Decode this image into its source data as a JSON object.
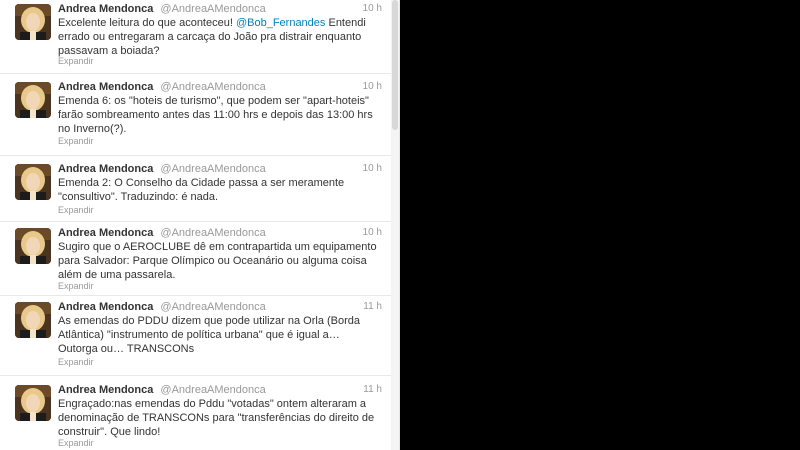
{
  "tweets": [
    {
      "name": "Andrea Mendonca",
      "handle": "@AndreaAMendonca",
      "time": "10 h",
      "text_before": "Excelente leitura do que aconteceu! ",
      "mention": "@Bob_Fernandes",
      "text_after": " Entendi errado ou entregaram a carcaça do João pra distrair enquanto passavam a boiada?",
      "expand": "Expandir"
    },
    {
      "name": "Andrea Mendonca",
      "handle": "@AndreaAMendonca",
      "time": "10 h",
      "text": "Emenda 6: os \"hoteis de turismo\", que podem ser \"apart-hoteis\" farão sombreamento antes das 11:00 hrs e depois das 13:00 hrs no Inverno(?).",
      "expand": "Expandir"
    },
    {
      "name": "Andrea Mendonca",
      "handle": "@AndreaAMendonca",
      "time": "10 h",
      "text": "Emenda 2: O Conselho da Cidade passa a ser meramente \"consultivo\". Traduzindo: é nada.",
      "expand": "Expandir"
    },
    {
      "name": "Andrea Mendonca",
      "handle": "@AndreaAMendonca",
      "time": "10 h",
      "text": "Sugiro que o AEROCLUBE dê em contrapartida um equipamento para Salvador: Parque Olímpico ou Oceanário ou alguma coisa além de uma passarela.",
      "expand": "Expandir"
    },
    {
      "name": "Andrea Mendonca",
      "handle": "@AndreaAMendonca",
      "time": "11 h",
      "text": "As emendas do PDDU dizem que pode utilizar na Orla (Borda Atlântica) \"instrumento de política urbana\" que é igual a… Outorga ou… TRANSCONs",
      "expand": "Expandir"
    },
    {
      "name": "Andrea Mendonca",
      "handle": "@AndreaAMendonca",
      "time": "11 h",
      "text": "Engraçado:nas emendas do Pddu \"votadas\" ontem alteraram a denominação de TRANSCONs para \"transferências do direito de construir\". Que lindo!",
      "expand": "Expandir"
    }
  ]
}
